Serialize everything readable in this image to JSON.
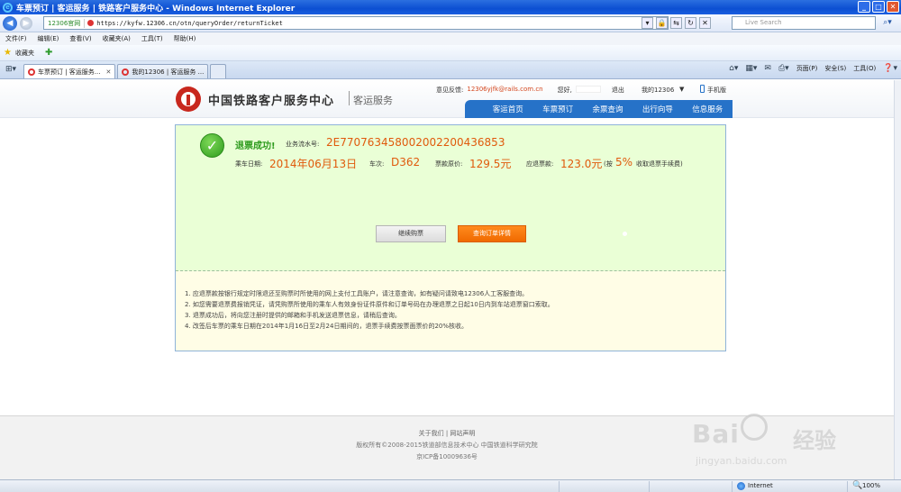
{
  "browser": {
    "title": "车票预订 | 客运服务 | 铁路客户服务中心 - Windows Internet Explorer",
    "url_tag": "12306官网",
    "url": "https://kyfw.12306.cn/otn/queryOrder/returnTicket",
    "search_placeholder": "Live Search",
    "menu": [
      "文件(F)",
      "编辑(E)",
      "查看(V)",
      "收藏夹(A)",
      "工具(T)",
      "帮助(H)"
    ],
    "favorites_label": "收藏夹",
    "tabs": [
      {
        "label": "车票预订 | 客运服务...",
        "active": true
      },
      {
        "label": "我的12306 | 客运服务 ...",
        "active": false
      }
    ],
    "cmd": {
      "page": "页面(P)",
      "safety": "安全(S)",
      "tools": "工具(O)"
    },
    "status_zone": "Internet",
    "zoom": "100%"
  },
  "header": {
    "logo_text": "中国铁路客户服务中心",
    "logo_sub": "客运服务",
    "feedback_label": "意见反馈:",
    "feedback_email": "12306yjfk@rails.com.cn",
    "greeting": "您好,",
    "logout": "退出",
    "my12306": "我的12306",
    "caret": "▼",
    "phone_label": "手机版",
    "nav": [
      "客运首页",
      "车票预订",
      "余票查询",
      "出行向导",
      "信息服务"
    ]
  },
  "result": {
    "title": "退票成功!",
    "serial_label": "业务流水号:",
    "serial_value": "2E770763458002002200436853",
    "date_label": "乘车日期:",
    "date_value": "2014年06月13日",
    "train_label": "车次:",
    "train_value": "D362",
    "price_label": "票款原价:",
    "price_value": "129.5元",
    "refund_label": "应退票款:",
    "refund_value": "123.0元",
    "fee_prefix": "(按",
    "fee_percent": "5%",
    "fee_suffix": "收取退票手续费)",
    "btn_continue": "继续购票",
    "btn_detail": "查询订单详情"
  },
  "notes": [
    "1. 应退票款按银行规定时限退还至购票时所使用的网上支付工具账户，请注意查询，如有疑问请致电12306人工客服查询。",
    "2. 如您需要退票费报销凭证，请凭购票所使用的乘车人有效身份证件原件和订单号码在办理退票之日起10日内到车站退票窗口索取。",
    "3. 退票成功后，将向您注册时提供的邮箱和手机发送退票信息，请稍后查询。",
    "4. 改签后车票的乘车日期在2014年1月16日至2月24日期间的，退票手续费按票面票价的20%核收。"
  ],
  "footer": {
    "links": "关于我们 | 网站声明",
    "copyright": "版权所有©2008-2015铁道部信息技术中心   中国铁道科学研究院",
    "icp": "京ICP备10009636号"
  },
  "watermark": {
    "big": "Bai",
    "cn": "经验",
    "url": "jingyan.baidu.com"
  }
}
